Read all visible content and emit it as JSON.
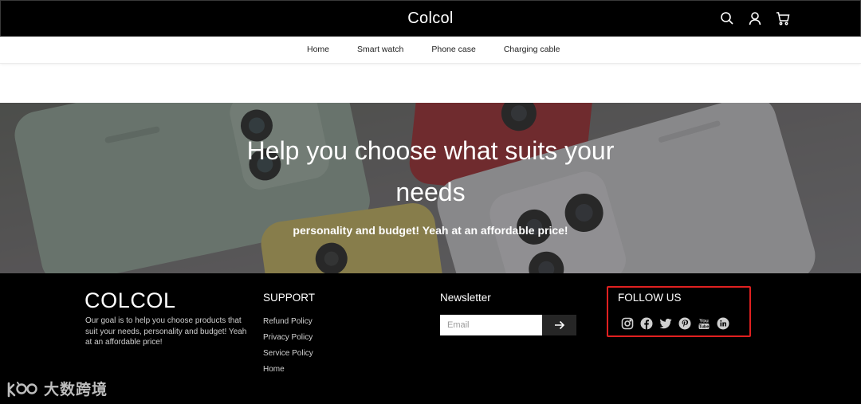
{
  "header": {
    "brand": "Colcol",
    "icons": [
      "search-icon",
      "user-icon",
      "cart-icon"
    ]
  },
  "nav": {
    "items": [
      {
        "label": "Home"
      },
      {
        "label": "Smart watch"
      },
      {
        "label": "Phone case"
      },
      {
        "label": "Charging cable"
      }
    ]
  },
  "hero": {
    "title_line1": "Help you choose what suits your",
    "title_line2": "needs",
    "subtitle": "personality and budget! Yeah at an affordable price!"
  },
  "footer": {
    "logo": "COLCOL",
    "description": "Our goal is to help you choose products that suit your needs, personality and budget! Yeah at an affordable price!",
    "support": {
      "title": "SUPPORT",
      "links": [
        {
          "label": "Refund Policy"
        },
        {
          "label": "Privacy Policy"
        },
        {
          "label": "Service Policy"
        },
        {
          "label": "Home"
        }
      ]
    },
    "newsletter": {
      "title": "Newsletter",
      "email_placeholder": "Email",
      "email_value": ""
    },
    "follow": {
      "title": "FOLLOW US",
      "icons": [
        "instagram-icon",
        "facebook-icon",
        "twitter-icon",
        "pinterest-icon",
        "youtube-icon",
        "linkedin-icon"
      ]
    }
  },
  "watermark": {
    "text": "大数跨境"
  },
  "colors": {
    "header_bg": "#000000",
    "footer_bg": "#000000",
    "highlight_border": "#e02020",
    "submit_bg": "#262626"
  }
}
